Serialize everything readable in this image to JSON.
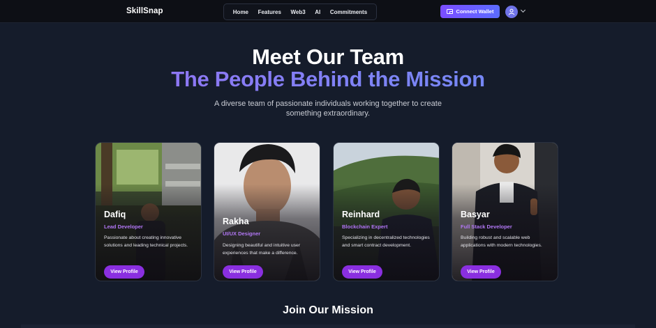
{
  "header": {
    "brand": "SkillSnap",
    "nav": [
      "Home",
      "Features",
      "Web3",
      "AI",
      "Commitments"
    ],
    "wallet_button": "Connect Wallet"
  },
  "hero": {
    "title": "Meet Our Team",
    "subtitle": "The People Behind the Mission",
    "description": "A diverse team of passionate individuals working together to create something extraordinary."
  },
  "team": [
    {
      "name": "Dafiq",
      "role": "Lead Developer",
      "description": "Passionate about creating innovative solutions and leading technical projects.",
      "button": "View Profile"
    },
    {
      "name": "Rakha",
      "role": "UI/UX Designer",
      "description": "Designing beautiful and intuitive user experiences that make a difference.",
      "button": "View Profile"
    },
    {
      "name": "Reinhard",
      "role": "Blockchain Expert",
      "description": "Specializing in decentralized technologies and smart contract development.",
      "button": "View Profile"
    },
    {
      "name": "Basyar",
      "role": "Full Stack Developer",
      "description": "Building robust and scalable web applications with modern technologies.",
      "button": "View Profile"
    }
  ],
  "join": {
    "title": "Join Our Mission"
  },
  "colors": {
    "background": "#151c2b",
    "accent": "#8a2fe0",
    "role_text": "#b277f5"
  },
  "icons": {
    "wallet": "wallet-icon",
    "avatar": "user-icon",
    "menu": "chevron-down-icon"
  }
}
